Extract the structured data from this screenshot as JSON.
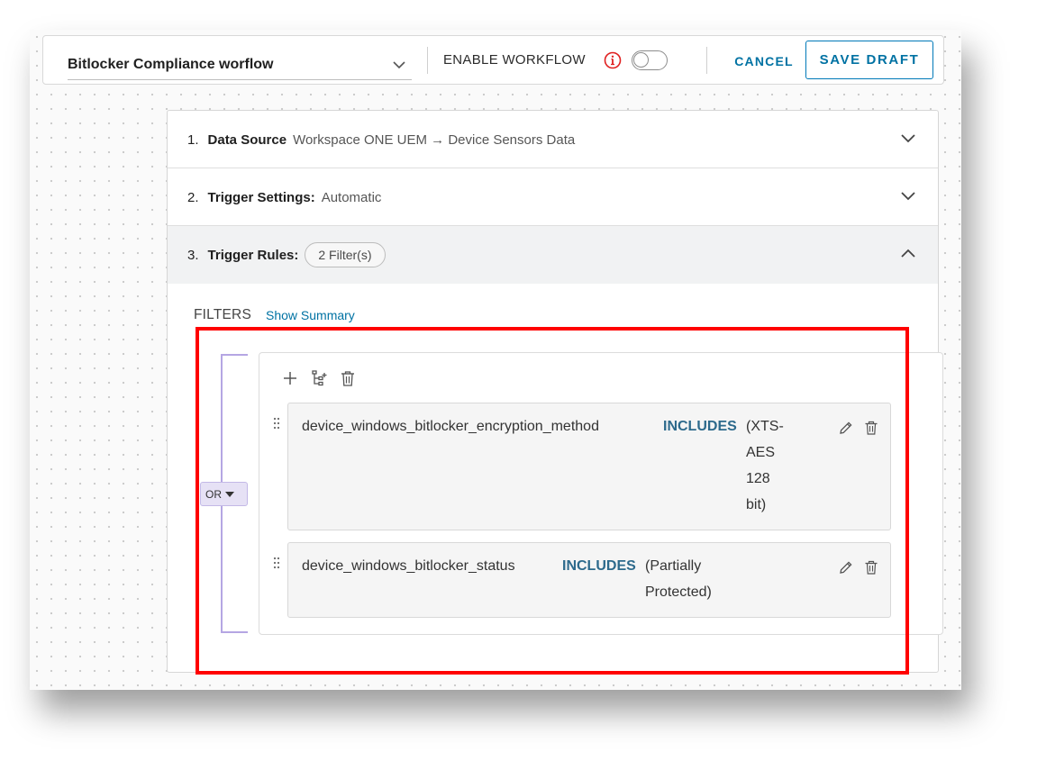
{
  "toolbar": {
    "workflow_name": "Bitlocker Compliance worflow",
    "enable_label": "ENABLE WORKFLOW",
    "enable_on": false,
    "cancel_label": "CANCEL",
    "save_label": "SAVE DRAFT",
    "info_icon": "info-icon",
    "accent_color": "#0072a3"
  },
  "steps": [
    {
      "num": "1.",
      "title": "Data Source",
      "value": "Workspace ONE UEM → Device Sensors Data",
      "expanded": false,
      "icon": "chevron-down-icon"
    },
    {
      "num": "2.",
      "title": "Trigger Settings:",
      "value": "Automatic",
      "expanded": false,
      "icon": "chevron-down-icon"
    },
    {
      "num": "3.",
      "title": "Trigger Rules:",
      "badge": "2 Filter(s)",
      "expanded": true,
      "icon": "chevron-up-icon"
    }
  ],
  "filters": {
    "label": "FILTERS",
    "summary_link": "Show Summary",
    "group_operator": "OR",
    "group_icons": [
      "plus-icon",
      "nested-group-icon",
      "trash-icon"
    ],
    "rules": [
      {
        "field": "device_windows_bitlocker_encryption_method",
        "operator": "INCLUDES",
        "value_lines": [
          "(XTS-",
          "AES",
          "128",
          "bit)"
        ]
      },
      {
        "field": "device_windows_bitlocker_status",
        "operator": "INCLUDES",
        "value_lines": [
          "(Partially",
          "Protected)"
        ]
      }
    ]
  },
  "highlight_color": "#ff0000"
}
